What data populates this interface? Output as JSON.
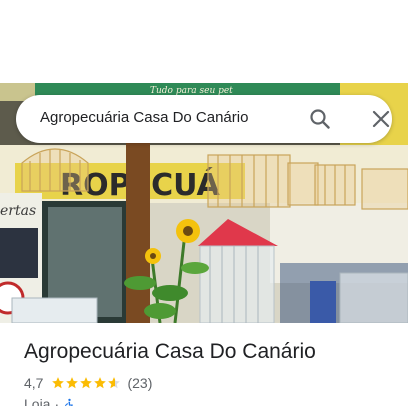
{
  "search": {
    "query": "Agropecuária Casa Do Canário"
  },
  "icons": {
    "search": "search-icon",
    "close": "close-icon",
    "star": "star-icon",
    "accessibility": "wheelchair-icon"
  },
  "photo": {
    "sign_text": "ROPECUÁ",
    "banner_text": "Tudo para seu pet",
    "side_text": "ertas"
  },
  "place": {
    "name": "Agropecuária Casa Do Canário",
    "rating": "4,7",
    "stars_value": 4.7,
    "stars_max": 5,
    "reviews": "(23)",
    "category": "Loja",
    "separator": "·"
  },
  "colors": {
    "star": "#fbbc04",
    "accent_blue": "#1a73e8",
    "sign_yellow": "#e8d34a",
    "roof_red": "#e0384b",
    "banner_green": "#2f8a57"
  }
}
